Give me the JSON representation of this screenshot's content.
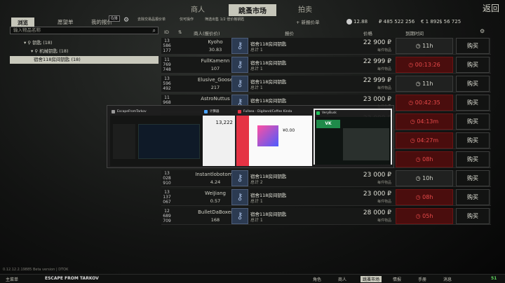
{
  "nav": {
    "tabs": [
      "商人",
      "跳蚤市场",
      "拍卖"
    ],
    "back": "返回"
  },
  "subbar": {
    "tabs": [
      "浏览",
      "愿望单",
      "我的报价"
    ],
    "offer_count": "0/8",
    "filters": [
      "去除交易品报价单",
      "仅可操作",
      "筛选出售 1/2 倍价格钥匙"
    ],
    "add_offer": "+ 新报价单",
    "currency": {
      "rep": "12.88",
      "rub": "₽ 485 522 256",
      "eur": "€ 1 892",
      "usd": "$ 56 725"
    }
  },
  "left": {
    "search_placeholder": "输入物品名称",
    "tree": [
      "钥匙 (18)",
      "机械钥匙 (18)",
      "宿舍118房间钥匙 (18)"
    ]
  },
  "table": {
    "headers": {
      "id": "ID",
      "seller": "商人(报价价)",
      "offer": "报价",
      "price": "价格",
      "time": "到期时间"
    },
    "price_unit": "每件物品",
    "buy": "购买",
    "item_name": "宿舍118房间钥匙",
    "rows": [
      {
        "id": [
          "13",
          "586",
          "177"
        ],
        "seller": "Kyoho",
        "rep": "30.83",
        "total": "总计 1",
        "price": "22 900 ₽",
        "time": "11h",
        "red": false
      },
      {
        "id": [
          "11",
          "769",
          "748"
        ],
        "seller": "FullKamenn",
        "rep": "107",
        "total": "总计 1",
        "price": "22 999 ₽",
        "time": "00:13:26",
        "red": true
      },
      {
        "id": [
          "13",
          "596",
          "492"
        ],
        "seller": "Elusive_Goose",
        "rep": "217",
        "total": "总计 1",
        "price": "22 999 ₽",
        "time": "11h",
        "red": false
      },
      {
        "id": [
          "11",
          "968",
          ""
        ],
        "seller": "AstroNuttus",
        "rep": "",
        "total": "",
        "price": "23 000 ₽",
        "time": "00:42:35",
        "red": true
      },
      {
        "id": [
          "",
          "",
          ""
        ],
        "seller": "",
        "rep": "",
        "total": "",
        "price": "23 000 ₽",
        "time": "04:13m",
        "red": true
      },
      {
        "id": [
          "",
          "",
          ""
        ],
        "seller": "",
        "rep": "",
        "total": "",
        "price": "23 000 ₽",
        "time": "04:27m",
        "red": true
      },
      {
        "id": [
          "",
          "",
          ""
        ],
        "seller": "",
        "rep": "",
        "total": "",
        "price": "23 000 ₽",
        "time": "08h",
        "red": true
      },
      {
        "id": [
          "13",
          "028",
          "910"
        ],
        "seller": "Instantlobotomy",
        "rep": "4.24",
        "total": "总计 2",
        "price": "23 000 ₽",
        "time": "10h",
        "red": false
      },
      {
        "id": [
          "13",
          "137",
          "067"
        ],
        "seller": "WeiJiang",
        "rep": "0.57",
        "total": "总计 1",
        "price": "23 000 ₽",
        "time": "08h",
        "red": true
      },
      {
        "id": [
          "12",
          "689",
          "709"
        ],
        "seller": "BulletDaBoxer",
        "rep": "168",
        "total": "总计 1",
        "price": "28 000 ₽",
        "time": "05h",
        "red": true
      }
    ]
  },
  "alttab": {
    "windows": [
      "EscapeFromTarkov",
      "计算器",
      "Fullsea - Digitand/Coffee Kinda",
      "VeryBusk"
    ],
    "calc_value": "13,222",
    "price_label": "¥0.00"
  },
  "status": "0.12.12.2.19885 Beta version | DTOK",
  "taskbar": {
    "left": [
      "主菜单",
      "ESCAPE FROM TARKOV"
    ],
    "right": [
      "角色",
      "商人",
      "跳蚤市场",
      "情报",
      "手册",
      "消息"
    ],
    "fps": "51"
  },
  "colors": {
    "accent": "#c6c6ba",
    "danger": "#e84a4a",
    "item_icon": "#2c3b52"
  }
}
